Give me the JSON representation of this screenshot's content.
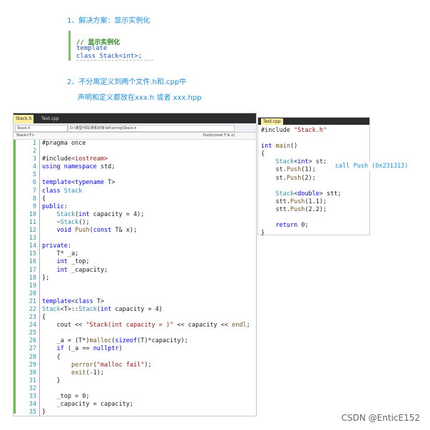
{
  "notes": {
    "item1": "1、解决方案：显示实例化",
    "item2": "2、不分离定义到两个文件.h和.cpp中",
    "item2_sub": "声明和定义都放在xxx.h  或者 xxx.hpp"
  },
  "snippet": [
    {
      "text": "// 显示实例化",
      "color": "#2e8b1e",
      "bold": true
    },
    {
      "text": "template",
      "color": "#1e55c8",
      "bold": false
    },
    {
      "text": "class Stack<int>;",
      "color": "#1e55c8",
      "bold": false
    }
  ],
  "left_editor": {
    "tabs": [
      "Stack.h",
      "Test.cpp"
    ],
    "nav_file": "Stack.h",
    "nav_path": "D:\\课堂代码\\类和对象\\bit\\string\\Stack.h",
    "scope_left": "Stack<T>",
    "scope_right": "Push(const T & x)",
    "lines": [
      [
        {
          "t": "#pragma once",
          "c": "#1e1e1e"
        }
      ],
      [],
      [
        {
          "t": "#include",
          "c": "#1e1e1e"
        },
        {
          "t": "<iostream>",
          "c": "#a31515"
        }
      ],
      [
        {
          "t": "using namespace ",
          "c": "#0000ff"
        },
        {
          "t": "std",
          "c": "#1e1e1e"
        },
        {
          "t": ";",
          "c": "#1e1e1e"
        }
      ],
      [],
      [
        {
          "t": "template",
          "c": "#0000ff"
        },
        {
          "t": "<",
          "c": "#1e1e1e"
        },
        {
          "t": "typename",
          "c": "#0000ff"
        },
        {
          "t": " T>",
          "c": "#1e1e1e"
        }
      ],
      [
        {
          "t": "class ",
          "c": "#0000ff"
        },
        {
          "t": "Stack",
          "c": "#2b91af"
        }
      ],
      [
        {
          "t": "{",
          "c": "#1e1e1e"
        }
      ],
      [
        {
          "t": "public",
          "c": "#0000ff"
        },
        {
          "t": ":",
          "c": "#1e1e1e"
        }
      ],
      [
        {
          "t": "    ",
          "c": "#1e1e1e"
        },
        {
          "t": "Stack",
          "c": "#2b91af"
        },
        {
          "t": "(",
          "c": "#1e1e1e"
        },
        {
          "t": "int",
          "c": "#0000ff"
        },
        {
          "t": " capacity = 4);",
          "c": "#1e1e1e"
        }
      ],
      [
        {
          "t": "    ~",
          "c": "#1e1e1e"
        },
        {
          "t": "Stack",
          "c": "#2b91af"
        },
        {
          "t": "();",
          "c": "#1e1e1e"
        }
      ],
      [
        {
          "t": "    ",
          "c": "#1e1e1e"
        },
        {
          "t": "void",
          "c": "#0000ff"
        },
        {
          "t": " ",
          "c": "#1e1e1e"
        },
        {
          "t": "Push",
          "c": "#74531f"
        },
        {
          "t": "(",
          "c": "#1e1e1e"
        },
        {
          "t": "const",
          "c": "#0000ff"
        },
        {
          "t": " T& x);",
          "c": "#1e1e1e"
        }
      ],
      [],
      [
        {
          "t": "private",
          "c": "#0000ff"
        },
        {
          "t": ":",
          "c": "#1e1e1e"
        }
      ],
      [
        {
          "t": "    T* _a;",
          "c": "#1e1e1e"
        }
      ],
      [
        {
          "t": "    ",
          "c": "#1e1e1e"
        },
        {
          "t": "int",
          "c": "#0000ff"
        },
        {
          "t": " _top;",
          "c": "#1e1e1e"
        }
      ],
      [
        {
          "t": "    ",
          "c": "#1e1e1e"
        },
        {
          "t": "int",
          "c": "#0000ff"
        },
        {
          "t": " _capacity;",
          "c": "#1e1e1e"
        }
      ],
      [
        {
          "t": "};",
          "c": "#1e1e1e"
        }
      ],
      [],
      [],
      [
        {
          "t": "template",
          "c": "#0000ff"
        },
        {
          "t": "<",
          "c": "#1e1e1e"
        },
        {
          "t": "class",
          "c": "#0000ff"
        },
        {
          "t": " T>",
          "c": "#1e1e1e"
        }
      ],
      [
        {
          "t": "Stack",
          "c": "#2b91af"
        },
        {
          "t": "<T>::",
          "c": "#1e1e1e"
        },
        {
          "t": "Stack",
          "c": "#2b91af"
        },
        {
          "t": "(",
          "c": "#1e1e1e"
        },
        {
          "t": "int",
          "c": "#0000ff"
        },
        {
          "t": " capacity = 4)",
          "c": "#1e1e1e"
        }
      ],
      [
        {
          "t": "{",
          "c": "#1e1e1e"
        }
      ],
      [
        {
          "t": "    cout",
          "c": "#1e1e1e"
        },
        {
          "t": " << ",
          "c": "#1e1e1e"
        },
        {
          "t": "\"Stack(int capacity = )\"",
          "c": "#a31515"
        },
        {
          "t": " << capacity << ",
          "c": "#1e1e1e"
        },
        {
          "t": "endl",
          "c": "#74531f"
        },
        {
          "t": ";",
          "c": "#1e1e1e"
        }
      ],
      [],
      [
        {
          "t": "    _a = (T*)",
          "c": "#1e1e1e"
        },
        {
          "t": "malloc",
          "c": "#74531f"
        },
        {
          "t": "(",
          "c": "#1e1e1e"
        },
        {
          "t": "sizeof",
          "c": "#0000ff"
        },
        {
          "t": "(T)*capacity);",
          "c": "#1e1e1e"
        }
      ],
      [
        {
          "t": "    ",
          "c": "#1e1e1e"
        },
        {
          "t": "if",
          "c": "#0000ff"
        },
        {
          "t": " (_a == ",
          "c": "#1e1e1e"
        },
        {
          "t": "nullptr",
          "c": "#0000ff"
        },
        {
          "t": ")",
          "c": "#1e1e1e"
        }
      ],
      [
        {
          "t": "    {",
          "c": "#1e1e1e"
        }
      ],
      [
        {
          "t": "        ",
          "c": "#1e1e1e"
        },
        {
          "t": "perror",
          "c": "#74531f"
        },
        {
          "t": "(",
          "c": "#1e1e1e"
        },
        {
          "t": "\"malloc fail\"",
          "c": "#a31515"
        },
        {
          "t": ");",
          "c": "#1e1e1e"
        }
      ],
      [
        {
          "t": "        ",
          "c": "#1e1e1e"
        },
        {
          "t": "exit",
          "c": "#74531f"
        },
        {
          "t": "(-1);",
          "c": "#1e1e1e"
        }
      ],
      [
        {
          "t": "    }",
          "c": "#1e1e1e"
        }
      ],
      [],
      [
        {
          "t": "    _top = 0;",
          "c": "#1e1e1e"
        }
      ],
      [
        {
          "t": "    _capacity = capacity;",
          "c": "#1e1e1e"
        }
      ],
      [
        {
          "t": "}",
          "c": "#1e1e1e"
        }
      ]
    ]
  },
  "right_editor": {
    "tab": "Test.cpp",
    "lines": [
      [
        {
          "t": "#include ",
          "c": "#1e1e1e"
        },
        {
          "t": "\"Stack.h\"",
          "c": "#a31515"
        }
      ],
      [],
      [
        {
          "t": "int",
          "c": "#0000ff"
        },
        {
          "t": " ",
          "c": "#1e1e1e"
        },
        {
          "t": "main",
          "c": "#74531f"
        },
        {
          "t": "()",
          "c": "#1e1e1e"
        }
      ],
      [
        {
          "t": "{",
          "c": "#1e1e1e"
        }
      ],
      [
        {
          "t": "    ",
          "c": "#1e1e1e"
        },
        {
          "t": "Stack",
          "c": "#2b91af"
        },
        {
          "t": "<",
          "c": "#1e1e1e"
        },
        {
          "t": "int",
          "c": "#0000ff"
        },
        {
          "t": "> st;",
          "c": "#1e1e1e"
        }
      ],
      [
        {
          "t": "    st.",
          "c": "#1e1e1e"
        },
        {
          "t": "Push",
          "c": "#74531f"
        },
        {
          "t": "(1);",
          "c": "#1e1e1e"
        }
      ],
      [
        {
          "t": "    st.",
          "c": "#1e1e1e"
        },
        {
          "t": "Push",
          "c": "#74531f"
        },
        {
          "t": "(2);",
          "c": "#1e1e1e"
        }
      ],
      [],
      [
        {
          "t": "    ",
          "c": "#1e1e1e"
        },
        {
          "t": "Stack",
          "c": "#2b91af"
        },
        {
          "t": "<",
          "c": "#1e1e1e"
        },
        {
          "t": "double",
          "c": "#0000ff"
        },
        {
          "t": "> stt;",
          "c": "#1e1e1e"
        }
      ],
      [
        {
          "t": "    stt.",
          "c": "#1e1e1e"
        },
        {
          "t": "Push",
          "c": "#74531f"
        },
        {
          "t": "(1.1);",
          "c": "#1e1e1e"
        }
      ],
      [
        {
          "t": "    stt.",
          "c": "#1e1e1e"
        },
        {
          "t": "Push",
          "c": "#74531f"
        },
        {
          "t": "(2.2);",
          "c": "#1e1e1e"
        }
      ],
      [],
      [
        {
          "t": "    ",
          "c": "#1e1e1e"
        },
        {
          "t": "return",
          "c": "#0000ff"
        },
        {
          "t": " 0;",
          "c": "#1e1e1e"
        }
      ],
      [
        {
          "t": "}",
          "c": "#1e1e1e"
        }
      ]
    ]
  },
  "call_note": "call Push (0x231313)",
  "watermark": "CSDN @EnticE152"
}
